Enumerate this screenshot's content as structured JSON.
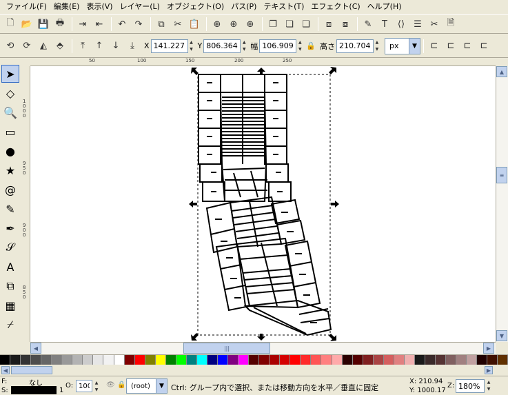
{
  "menu": [
    "ファイル(F)",
    "編集(E)",
    "表示(V)",
    "レイヤー(L)",
    "オブジェクト(O)",
    "パス(P)",
    "テキスト(T)",
    "エフェクト(C)",
    "ヘルプ(H)"
  ],
  "commands": {
    "icons": [
      "new-icon",
      "open-icon",
      "save-icon",
      "print-icon",
      "import-icon",
      "export-icon",
      "undo-icon",
      "redo-icon",
      "copy-icon",
      "cut-icon",
      "paste-icon",
      "zoom-selection-icon",
      "zoom-drawing-icon",
      "zoom-page-icon",
      "duplicate-icon",
      "clone-icon",
      "unlink-clone-icon",
      "group-icon",
      "ungroup-icon",
      "fill-stroke-icon",
      "text-font-icon",
      "xml-editor-icon",
      "align-icon",
      "preferences-icon",
      "document-properties-icon"
    ]
  },
  "controls": {
    "x_label": "X",
    "x_value": "141.227",
    "y_label": "Y",
    "y_value": "806.364",
    "w_label": "幅",
    "w_value": "106.909",
    "h_label": "高さ",
    "h_value": "210.704",
    "unit": "px"
  },
  "ruler": {
    "h_ticks": [
      "50",
      "100",
      "150",
      "200",
      "250"
    ],
    "v_ticks": [
      "1000",
      "950",
      "900",
      "850"
    ]
  },
  "tools": [
    "selector-icon",
    "node-editor-icon",
    "zoom-icon",
    "rectangle-icon",
    "ellipse-icon",
    "star-icon",
    "spiral-icon",
    "pencil-icon",
    "pen-icon",
    "calligraphy-icon",
    "text-icon",
    "connector-icon",
    "gradient-icon",
    "dropper-icon"
  ],
  "palette": [
    "#000000",
    "#1a1a1a",
    "#333333",
    "#4d4d4d",
    "#666666",
    "#808080",
    "#999999",
    "#b3b3b3",
    "#cccccc",
    "#e6e6e6",
    "#f2f2f2",
    "#ffffff",
    "#800000",
    "#ff0000",
    "#808000",
    "#ffff00",
    "#008000",
    "#00ff00",
    "#008080",
    "#00ffff",
    "#000080",
    "#0000ff",
    "#800080",
    "#ff00ff",
    "#550000",
    "#800000",
    "#aa0000",
    "#d40000",
    "#ff0000",
    "#ff2a2a",
    "#ff5555",
    "#ff8080",
    "#ffaaaa",
    "#2b0000",
    "#550000",
    "#802020",
    "#aa4444",
    "#d45f5f",
    "#e08080",
    "#f0b0b0",
    "#1a1a1a",
    "#3a2a2a",
    "#553333",
    "#806060",
    "#a08080",
    "#c0a0a0",
    "#200000",
    "#401000",
    "#603000"
  ],
  "status": {
    "fill_label": "F:",
    "fill_value": "なし",
    "stroke_label": "S:",
    "stroke_width": "1",
    "opacity_label": "O:",
    "opacity_value": "100",
    "layer": "(root)",
    "message": "Ctrl: グループ内で選択、または移動方向を水平／垂直に固定",
    "cursor_x": "X: 210.94",
    "cursor_y": "Y: 1000.17",
    "zoom_label": "Z:",
    "zoom_value": "180%"
  }
}
